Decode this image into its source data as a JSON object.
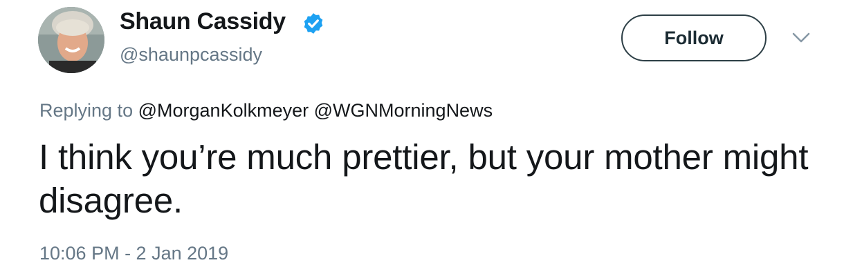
{
  "author": {
    "display_name": "Shaun Cassidy",
    "handle": "@shaunpcassidy",
    "verified": true,
    "avatar_icon": "profile-photo"
  },
  "actions": {
    "follow_label": "Follow",
    "more_icon": "chevron-down-icon"
  },
  "reply": {
    "prefix": "Replying to",
    "mentions": [
      "@MorganKolkmeyer",
      "@WGNMorningNews"
    ]
  },
  "tweet": {
    "text": "I think you’re much prettier, but your mother might disagree.",
    "timestamp": "10:06 PM - 2 Jan 2019"
  },
  "colors": {
    "verified_blue": "#1da1f2",
    "secondary_text": "#657786",
    "primary_text": "#14171a",
    "follow_border": "#2c3e45"
  }
}
